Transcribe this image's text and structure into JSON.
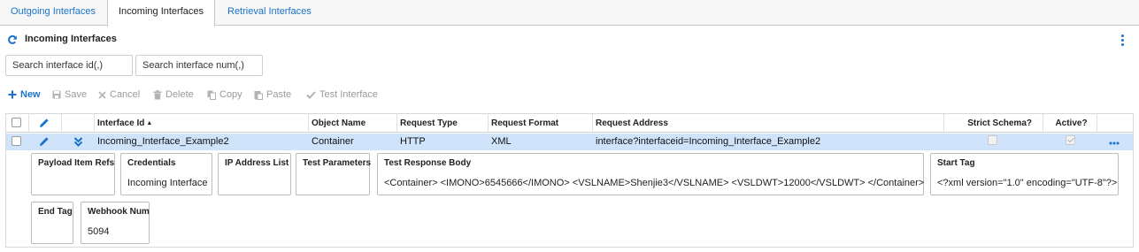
{
  "tabs": [
    {
      "label": "Outgoing Interfaces"
    },
    {
      "label": "Incoming Interfaces"
    },
    {
      "label": "Retrieval Interfaces"
    }
  ],
  "header": {
    "title": "Incoming Interfaces"
  },
  "search": {
    "id_placeholder": "Search interface id(,)",
    "num_placeholder": "Search interface num(,)"
  },
  "toolbar": {
    "new": "New",
    "save": "Save",
    "cancel": "Cancel",
    "delete": "Delete",
    "copy": "Copy",
    "paste": "Paste",
    "test": "Test Interface"
  },
  "columns": {
    "interface_id": "Interface Id",
    "object_name": "Object Name",
    "request_type": "Request Type",
    "request_format": "Request Format",
    "request_address": "Request Address",
    "strict_schema": "Strict Schema?",
    "active": "Active?"
  },
  "row": {
    "interface_id": "Incoming_Interface_Example2",
    "object_name": "Container",
    "request_type": "HTTP",
    "request_format": "XML",
    "request_address": "interface?interfaceid=Incoming_Interface_Example2",
    "strict_schema": false,
    "active": true
  },
  "details": {
    "payload_item_refs": {
      "label": "Payload Item Refs",
      "value": ""
    },
    "credentials": {
      "label": "Credentials",
      "value": "Incoming Interface"
    },
    "ip_address_list": {
      "label": "IP Address List",
      "value": ""
    },
    "test_parameters": {
      "label": "Test Parameters",
      "value": ""
    },
    "test_response_body": {
      "label": "Test Response Body",
      "value": "<Container> <IMONO>6545666</IMONO> <VSLNAME>Shenjie3</VSLNAME> <VSLDWT>12000</VSLDWT> </Container>"
    },
    "start_tag": {
      "label": "Start Tag",
      "value": "<?xml version=\"1.0\" encoding=\"UTF-8\"?>"
    },
    "end_tag": {
      "label": "End Tag",
      "value": ""
    },
    "webhook_num": {
      "label": "Webhook Num",
      "value": "5094"
    }
  },
  "colors": {
    "accent": "#1a73c8",
    "selected_row": "#cfe3fb",
    "disabled": "#9a9a9a"
  }
}
